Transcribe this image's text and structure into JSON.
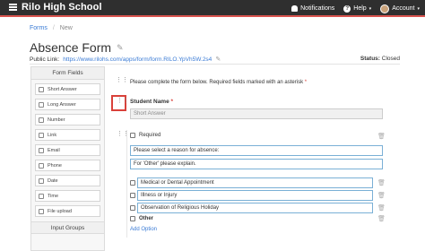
{
  "app": {
    "brand": "Rilo High School"
  },
  "nav": {
    "notifications": "Notifications",
    "help": "Help",
    "account": "Account",
    "caret": "▾"
  },
  "breadcrumb": {
    "root": "Forms",
    "sep": "/",
    "current": "New"
  },
  "page": {
    "title": "Absence Form",
    "public_link_label": "Public Link:",
    "public_link_url": "https://www.rilohs.com/apps/form/form.RILO.YpVh5W.2s4",
    "status_label": "Status:",
    "status_value": "Closed"
  },
  "sidebar": {
    "header": "Form Fields",
    "items": [
      {
        "label": "Short Answer",
        "icon": "short-answer-icon"
      },
      {
        "label": "Long Answer",
        "icon": "long-answer-icon"
      },
      {
        "label": "Number",
        "icon": "number-icon"
      },
      {
        "label": "Link",
        "icon": "link-icon"
      },
      {
        "label": "Email",
        "icon": "email-icon"
      },
      {
        "label": "Phone",
        "icon": "phone-icon"
      },
      {
        "label": "Date",
        "icon": "date-icon"
      },
      {
        "label": "Time",
        "icon": "time-icon"
      },
      {
        "label": "File upload",
        "icon": "file-upload-icon"
      }
    ],
    "header2": "Input Groups"
  },
  "form": {
    "intro": "Please complete the form below. Required fields marked with an asterisk",
    "intro_asterisk": "*",
    "student_label": "Student Name",
    "student_asterisk": "*",
    "student_placeholder": "Short Answer",
    "required_label": "Required",
    "prompt": "Please select a reason for absence:",
    "other_prompt": "For 'Other' please explain.",
    "options": [
      "Medical or Dental Appointment",
      "Illness or Injury",
      "Observation of Religious Holiday"
    ],
    "other_label": "Other",
    "add_option": "Add Option"
  },
  "colors": {
    "accent": "#d9413a",
    "link": "#3a7bd5",
    "topbar": "#2f2f2f"
  }
}
